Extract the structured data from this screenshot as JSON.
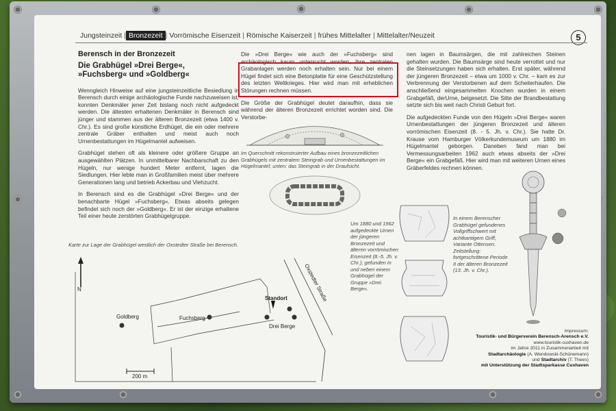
{
  "nav": {
    "items": [
      "Jungsteinzeit",
      "Bronzezeit",
      "Vorrömische Eisenzeit",
      "Römische Kaiserzeit",
      "frühes Mittelalter",
      "Mittelalter/Neuzeit"
    ],
    "active_index": 1,
    "page_number": "5"
  },
  "col1": {
    "heading": "Berensch in der Bronzezeit",
    "subheading_line1": "Die Grabhügel »Drei Berge«,",
    "subheading_line2": "»Fuchsberg« und »Goldberg«",
    "para1": "Wenngleich Hinweise auf eine jungsteinzeitliche Besiedlung in Berensch durch einige archäologische Funde nachzuweisen ist, konnten Denkmäler jener Zeit bislang noch nicht aufgedeckt werden. Die ältesten erhaltenen Denkmäler in Berensch sind jünger und stammen aus der älteren Bronzezeit (etwa 1400 v. Chr.). Es sind große künstliche Erdhügel, die ein oder mehrere zentrale Gräber enthalten und meist auch noch Urnenbestattungen im Hügelmantel aufweisen.",
    "para2": "Grabhügel stehen oft als kleinere oder größere Gruppe an ausgewählten Plätzen. In unmittelbarer Nachbarschaft zu den Hügeln, nur wenige hundert Meter entfernt, lagen die Siedlungen. Hier lebte man in Großfamilien meist über mehrere Generationen lang und betrieb Ackerbau und Viehzucht.",
    "para3": "In Berensch sind es die Grabhügel »Drei Berge« und der benachbarte Hügel »Fuchsberg«. Etwas abseits gelegen befindet sich noch der »Goldberg«. Er ist der einzige erhaltene Teil einer heute zerstörten Grabhügelgruppe."
  },
  "col2": {
    "para1_start": "Die »Drei Berge« wie auch der »Fuchsberg« sind archäologisch kaum untersucht worden, ihre zentralen Grabanlagen",
    "para1_highlight": "werden noch erhalten sein. Nur bei einem Hügel findet sich eine Betonplatte für eine Geschützstellung des letzten Weltkrieges. Hier wird man mit erheblichen Störungen rechnen müssen.",
    "para2": "Die Größe der Grabhügel deutet daraufhin, dass sie während der älteren Bronzezeit errichtet worden sind. Die Verstorbe-",
    "caption_mound": "Im Querschnitt rekonstruierter Aufbau eines bronzezeitlichen Grabhügels mit zentralem Steingrab und Urnenbestattungen im Hügelmantel; unten: das Steingrab in der Draufsicht.",
    "caption_urns": "Um 1880 und 1962 aufgedeckte Urnen der jüngeren Bronzezeit und älteren vorrömischen Eisenzeit (8.-5. Jh. v. Chr.); gefunden in und neben einem Grabhügel der Gruppe »Drei Berge«."
  },
  "col3": {
    "para1": "nen lagen in Baumsärgen, die mit zahlreichen Steinen gehalten wurden. Die Baumsärge sind heute verrottet und nur die Steinsetzungen haben sich erhalten. Erst später, während der jüngeren Bronzezeit – etwa um 1000 v. Chr. – kam es zur Verbrennung der Verstorbenen auf dem Scheiterhaufen. Die anschließend eingesammelten Knochen wurden in einem Grabgefäß, derUrne, beigesetzt. Die Sitte der Brandbestattung setzte sich bis weit nach Christi Geburt fort.",
    "para2": "Die aufgedeckten Funde von den Hügeln »Drei Berge« waren Urnenbestattungen der jüngeren Bronzezeit und älteren vorrömischen Eisenzeit (8. - 5. Jh. v. Chr.). Sie hatte Dr. Krause vom Hamburger Völkerkundemuseum um 1880 im Hügelmantel geborgen. Daneben fand man bei Vermessungsarbeiten 1962 auch etwas abseits der »Drei Berge« ein Grabgefäß. Hier wird man mit weiteren Urnen eines Gräberfeldes rechnen können.",
    "caption_sword": "In einem Berenscher Grabhügel gefundenes Vollgriffschwert mit achtkantigem Griff, Variante Ottensen. Zeitstellung: fortgeschrittene Periode II der älteren Bronzezeit (13. Jh. v. Chr.)."
  },
  "map": {
    "caption": "Karte zur Lage der Grabhügel westlich der Oxstedter Straße bei Berensch.",
    "labels": {
      "goldberg": "Goldberg",
      "fuchsberg": "Fuchsberg",
      "standort": "Standort",
      "drei_berge": "Drei Berge",
      "road": "Oxstedter Straße",
      "scale": "200 m",
      "north": "N"
    }
  },
  "imprint": {
    "title": "Impressum:",
    "org": "Touristik- und Bürgerverein Berensch-Arensch e.V.",
    "url": "www.touristik-cuxhaven.de",
    "line1": "im Jahre 2011 in Zusammenarbeit mit",
    "line2_bold": "Stadtarchäologie",
    "line2_rest": "(A. Wendowski-Schünemann)",
    "line3_pre": "und",
    "line3_bold": "Stadtarchiv",
    "line3_rest": "(T. Thees)",
    "line4": "mit Unterstützung der Stadtsparkasse Cuxhaven"
  }
}
